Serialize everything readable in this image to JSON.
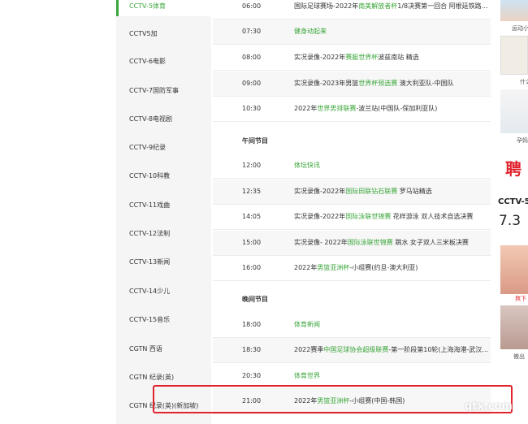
{
  "channels": [
    {
      "label": "CCTV-5体育",
      "active": true
    },
    {
      "label": "CCTV5加"
    },
    {
      "label": "CCTV-6电影"
    },
    {
      "label": "CCTV-7国防军事"
    },
    {
      "label": "CCTV-8电视剧"
    },
    {
      "label": "CCTV-9纪录"
    },
    {
      "label": "CCTV-10科教"
    },
    {
      "label": "CCTV-11戏曲"
    },
    {
      "label": "CCTV-12法制"
    },
    {
      "label": "CCTV-13新闻"
    },
    {
      "label": "CCTV-14少儿"
    },
    {
      "label": "CCTV-15音乐"
    },
    {
      "label": "CGTN 西语"
    },
    {
      "label": "CGTN 纪录(英)"
    },
    {
      "label": "CGTN 纪录(英)(新加坡)"
    }
  ],
  "schedule": {
    "rows": [
      {
        "time": "06:00",
        "pre": "国际足球赛场-2022年",
        "link": "南美解放者杯",
        "post": "1/8决赛第一回合 阿根廷铁路…"
      },
      {
        "time": "07:30",
        "pre": "",
        "link": "健身动起来",
        "post": ""
      },
      {
        "time": "08:00",
        "pre": "实况录像-2022年",
        "link": "赛艇世界杯",
        "post": "波兹南站 精选"
      },
      {
        "time": "09:00",
        "pre": "实况录像-2023年男篮",
        "link": "世界杯预选赛",
        "post": " 澳大利亚队-中国队"
      },
      {
        "time": "10:30",
        "pre": "2022年",
        "link": "世界男排联赛",
        "post": "-波兰站(中国队-保加利亚队)"
      }
    ],
    "afternoon_label": "午间节目",
    "afternoon": [
      {
        "time": "12:00",
        "pre": "",
        "link": "体坛快讯",
        "post": ""
      },
      {
        "time": "12:35",
        "pre": "实况录像-2022年",
        "link": "国际田联钻石联赛",
        "post": " 罗马站精选"
      },
      {
        "time": "14:05",
        "pre": "实况录像-2022年",
        "link": "国际泳联世锦赛",
        "post": " 花样游泳 双人技术自选决赛"
      },
      {
        "time": "15:00",
        "pre": "实况录像- 2022年",
        "link": "国际泳联世锦赛",
        "post": " 跳水 女子双人三米板决赛"
      },
      {
        "time": "16:00",
        "pre": "2022年",
        "link": "男篮亚洲杯",
        "post": "-小组赛(约旦-澳大利亚)"
      }
    ],
    "evening_label": "晚间节目",
    "evening": [
      {
        "time": "18:00",
        "pre": "",
        "link": "体育新闻",
        "post": ""
      },
      {
        "time": "18:30",
        "pre": "2022赛季",
        "link": "中国足球协会超级联赛",
        "post": "-第一阶段第10轮(上海海港-武汉…"
      },
      {
        "time": "20:30",
        "pre": "",
        "link": "体育世界",
        "post": ""
      },
      {
        "time": "21:00",
        "pre": "2022年",
        "link": "男篮亚洲杯",
        "post": "-小组赛(中国-韩国)"
      }
    ]
  },
  "right": {
    "cap1": "运动小",
    "cap2": "什么",
    "cap3": "孕妈",
    "recruit": "聘",
    "channel_name": "CCTV-5",
    "rating": "7.3",
    "cap4": "熬下",
    "cap5": "傲出"
  },
  "watermark": "qtx.com"
}
